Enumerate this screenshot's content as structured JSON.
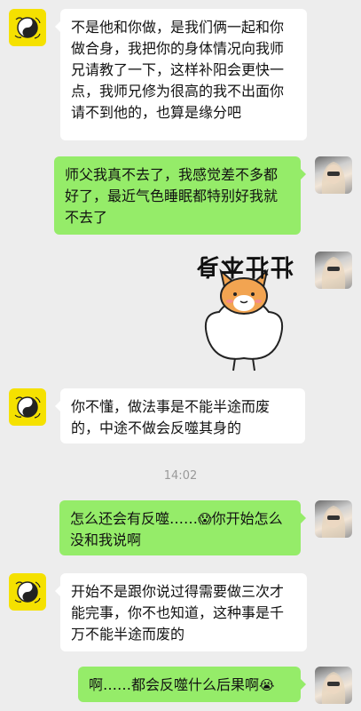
{
  "messages": [
    {
      "side": "left",
      "text": "不是他和你做，是我们俩一起和你做合身，我把你的身体情况向我师兄请教了一下，这样补阳会更快一点，我师兄修为很高的我不出面你请不到他的，也算是缘分吧"
    },
    {
      "side": "right",
      "text": "师父我真不去了，我感觉差不多都好了，最近气色睡眠都特别好我就不去了"
    },
    {
      "side": "right",
      "type": "sticker",
      "caption": "壮壮本身"
    },
    {
      "side": "left",
      "text": "你不懂，做法事是不能半途而废的，中途不做会反噬其身的"
    },
    {
      "side": "right",
      "text_a": "怎么还会有反噬……",
      "emoji": "😱",
      "text_b": "你开始怎么没和我说啊"
    },
    {
      "side": "left",
      "text": "开始不是跟你说过得需要做三次才能完事，你不也知道，这种事是千万不能半途而废的"
    },
    {
      "side": "right",
      "text_a": "啊……都会反噬什么后果啊",
      "emoji": "😭"
    }
  ],
  "timestamp": "14:02",
  "icons": {
    "master_avatar": "taiji-avatar-icon",
    "user_avatar": "user-photo-avatar-icon",
    "sticker": "strong-dog-sticker-icon"
  },
  "colors": {
    "background": "#ededed",
    "left_bubble": "#ffffff",
    "right_bubble": "#95ec69",
    "master_avatar_bg": "#f5e100"
  }
}
